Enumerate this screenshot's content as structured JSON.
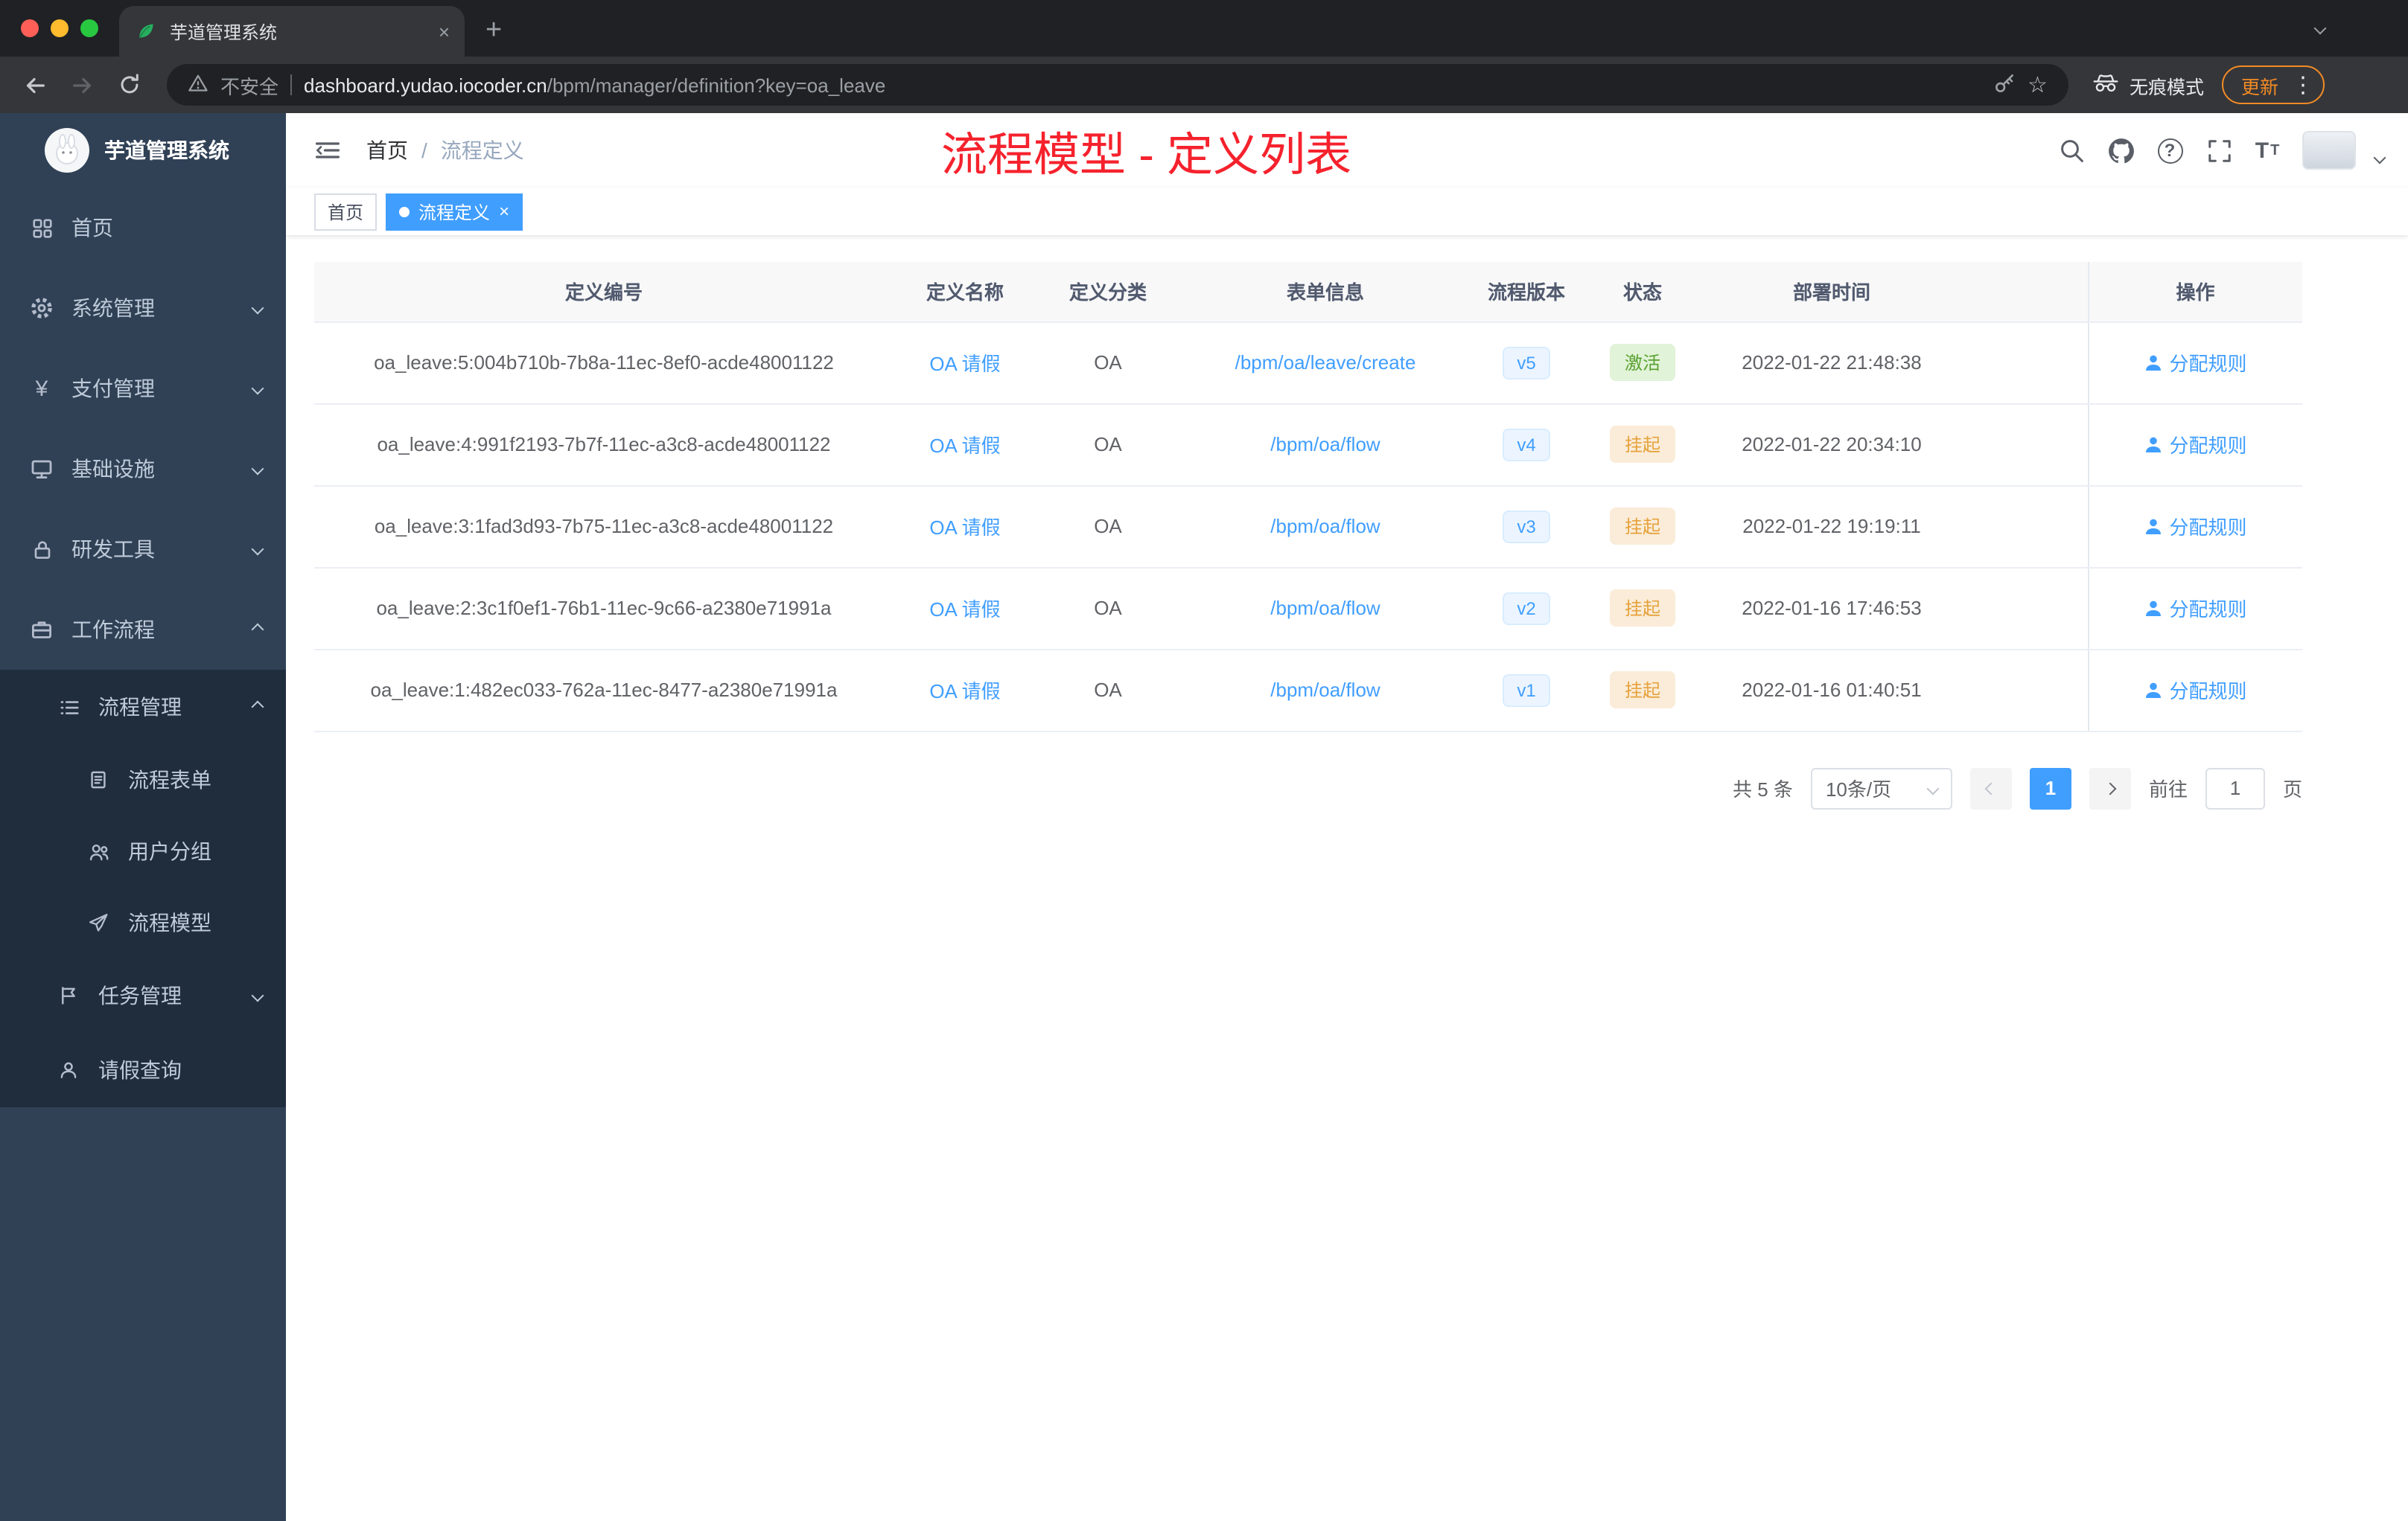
{
  "glyphs": {
    "close": "×",
    "plus": "+",
    "more": "⋮",
    "star": "☆"
  },
  "browser": {
    "tab_title": "芋道管理系统",
    "security_label": "不安全",
    "url_host": "dashboard.yudao.iocoder.cn",
    "url_path": "/bpm/manager/definition?key=oa_leave",
    "incognito_label": "无痕模式",
    "update_label": "更新"
  },
  "sidebar": {
    "logo_title": "芋道管理系统",
    "items": [
      {
        "label": "首页"
      },
      {
        "label": "系统管理"
      },
      {
        "label": "支付管理"
      },
      {
        "label": "基础设施"
      },
      {
        "label": "研发工具"
      },
      {
        "label": "工作流程"
      }
    ],
    "submenu_items": [
      {
        "label": "流程管理"
      },
      {
        "label": "流程表单"
      },
      {
        "label": "用户分组"
      },
      {
        "label": "流程模型"
      },
      {
        "label": "任务管理"
      },
      {
        "label": "请假查询"
      }
    ]
  },
  "header": {
    "breadcrumb_home": "首页",
    "breadcrumb_sep": "/",
    "breadcrumb_current": "流程定义",
    "annotation": "流程模型 - 定义列表"
  },
  "tags": [
    {
      "label": "首页",
      "active": false
    },
    {
      "label": "流程定义",
      "active": true
    }
  ],
  "table": {
    "columns": [
      "定义编号",
      "定义名称",
      "定义分类",
      "表单信息",
      "流程版本",
      "状态",
      "部署时间",
      "操作"
    ],
    "action_label": "分配规则",
    "rows": [
      {
        "id": "oa_leave:5:004b710b-7b8a-11ec-8ef0-acde48001122",
        "name": "OA 请假",
        "category": "OA",
        "form": "/bpm/oa/leave/create",
        "version": "v5",
        "status": "激活",
        "status_type": "success",
        "time": "2022-01-22 21:48:38"
      },
      {
        "id": "oa_leave:4:991f2193-7b7f-11ec-a3c8-acde48001122",
        "name": "OA 请假",
        "category": "OA",
        "form": "/bpm/oa/flow",
        "version": "v4",
        "status": "挂起",
        "status_type": "warning",
        "time": "2022-01-22 20:34:10"
      },
      {
        "id": "oa_leave:3:1fad3d93-7b75-11ec-a3c8-acde48001122",
        "name": "OA 请假",
        "category": "OA",
        "form": "/bpm/oa/flow",
        "version": "v3",
        "status": "挂起",
        "status_type": "warning",
        "time": "2022-01-22 19:19:11"
      },
      {
        "id": "oa_leave:2:3c1f0ef1-76b1-11ec-9c66-a2380e71991a",
        "name": "OA 请假",
        "category": "OA",
        "form": "/bpm/oa/flow",
        "version": "v2",
        "status": "挂起",
        "status_type": "warning",
        "time": "2022-01-16 17:46:53"
      },
      {
        "id": "oa_leave:1:482ec033-762a-11ec-8477-a2380e71991a",
        "name": "OA 请假",
        "category": "OA",
        "form": "/bpm/oa/flow",
        "version": "v1",
        "status": "挂起",
        "status_type": "warning",
        "time": "2022-01-16 01:40:51"
      }
    ]
  },
  "pagination": {
    "total_label": "共 5 条",
    "page_size_label": "10条/页",
    "current_page": "1",
    "goto_label": "前往",
    "goto_value": "1",
    "page_unit": "页"
  }
}
